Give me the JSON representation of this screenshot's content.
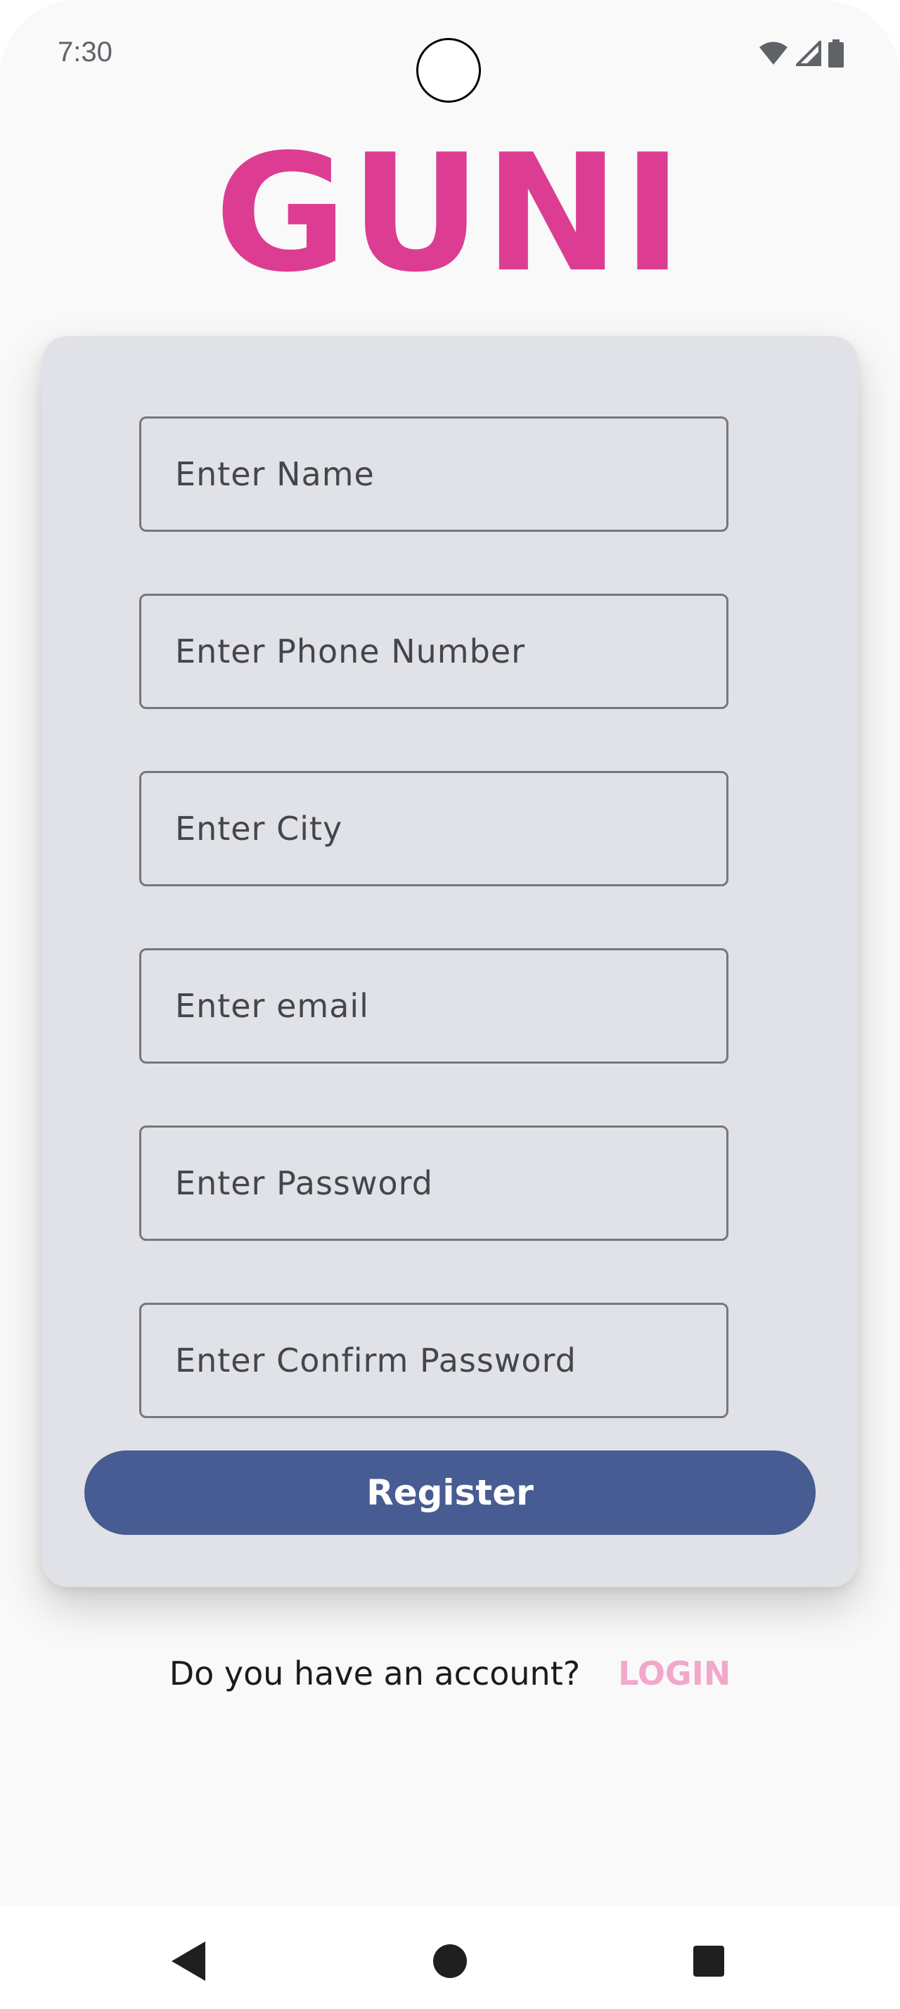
{
  "status_bar": {
    "time": "7:30",
    "icons": [
      "wifi-icon",
      "cellular-signal-icon",
      "battery-icon"
    ]
  },
  "app": {
    "logo_text": "GUNI",
    "brand_color": "#dc3d92"
  },
  "form": {
    "fields": [
      {
        "name": "name",
        "placeholder": "Enter Name"
      },
      {
        "name": "phone",
        "placeholder": "Enter Phone Number"
      },
      {
        "name": "city",
        "placeholder": "Enter City"
      },
      {
        "name": "email",
        "placeholder": "Enter email"
      },
      {
        "name": "password",
        "placeholder": "Enter Password"
      },
      {
        "name": "confirm-password",
        "placeholder": "Enter Confirm Password"
      }
    ],
    "register_label": "Register",
    "button_color": "#475c92"
  },
  "footer": {
    "account_prompt": "Do you have an account?",
    "login_label": "LOGIN",
    "login_color": "#f1a8cb"
  },
  "nav_bar": {
    "icons": [
      "back-icon",
      "home-icon",
      "recents-icon"
    ]
  }
}
